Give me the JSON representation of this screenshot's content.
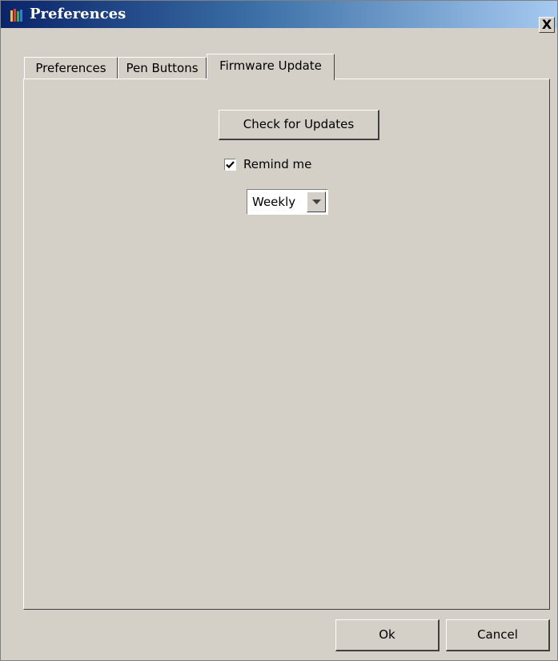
{
  "window": {
    "title": "Preferences",
    "close_label": "X"
  },
  "tabs": [
    {
      "label": "Preferences",
      "active": false
    },
    {
      "label": "Pen Buttons",
      "active": false
    },
    {
      "label": "Firmware Update",
      "active": true
    }
  ],
  "firmware": {
    "check_button_label": "Check for Updates",
    "remind_label": "Remind me",
    "remind_checked": true,
    "frequency_selected": "Weekly"
  },
  "footer": {
    "ok_label": "Ok",
    "cancel_label": "Cancel"
  },
  "colors": {
    "face": "#d4d0c8",
    "title_start": "#0a246a",
    "title_end": "#a6caf0"
  },
  "icons": {
    "app": "app-logo-icon",
    "close": "close-icon",
    "dropdown": "chevron-down-icon",
    "check": "checkmark-icon"
  }
}
